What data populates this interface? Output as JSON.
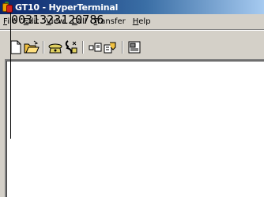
{
  "window": {
    "title": "GT10 - HyperTerminal",
    "icon": "hyperterminal-app-icon"
  },
  "menu": {
    "items": [
      {
        "label": "File",
        "accel": "F",
        "rest": "ile"
      },
      {
        "label": "Edit",
        "accel": "E",
        "rest": "dit"
      },
      {
        "label": "View",
        "accel": "V",
        "rest": "iew"
      },
      {
        "label": "Call",
        "accel": "C",
        "rest": "all"
      },
      {
        "label": "Transfer",
        "accel": "T",
        "rest": "ransfer"
      },
      {
        "label": "Help",
        "accel": "H",
        "rest": "elp"
      }
    ]
  },
  "toolbar": {
    "buttons": [
      {
        "icon": "new-connection-icon"
      },
      {
        "icon": "open-folder-icon"
      },
      {
        "icon": "call-phone-icon"
      },
      {
        "icon": "disconnect-phone-icon"
      },
      {
        "icon": "send-file-icon"
      },
      {
        "icon": "receive-file-icon"
      },
      {
        "icon": "properties-icon"
      }
    ]
  },
  "terminal": {
    "text": "0031323120786"
  }
}
